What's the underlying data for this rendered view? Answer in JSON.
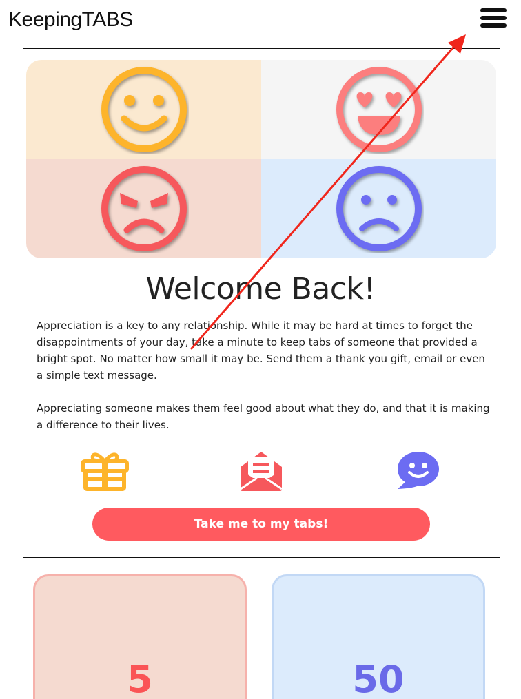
{
  "header": {
    "brand": "KeepingTABS",
    "menu_icon": "hamburger-menu-icon"
  },
  "mood_grid": {
    "cells": [
      {
        "icon": "smile-face-icon",
        "color": "#fdb42b",
        "background": "#fbe9d0"
      },
      {
        "icon": "heart-eyes-face-icon",
        "color": "#fc7e7e",
        "background": "#f5f5f5"
      },
      {
        "icon": "angry-face-icon",
        "color": "#f6585c",
        "background": "#f5dad0"
      },
      {
        "icon": "sad-face-icon",
        "color": "#6c6cf2",
        "background": "#dcebfc"
      }
    ]
  },
  "main": {
    "title": "Welcome Back!",
    "paragraph1": "Appreciation is a key to any relationship. While it may be hard at times to forget the disappointments of your day, take a minute to keep tabs of someone that provided a bright spot. No matter how small it may be. Send them a thank you gift, email or even a simple text message.",
    "paragraph2": "Appreciating someone makes them feel good about what they do, and that it is making a difference to their lives."
  },
  "actions": [
    {
      "icon": "gift-icon",
      "color": "#fdb42b"
    },
    {
      "icon": "open-envelope-icon",
      "color": "#f6585c"
    },
    {
      "icon": "chat-bubble-icon",
      "color": "#6c6cf2"
    }
  ],
  "cta": {
    "label": "Take me to my tabs!",
    "color": "#ff5a5f"
  },
  "stats": [
    {
      "value": "5",
      "color": "#fa5456"
    },
    {
      "value": "50",
      "color": "#6a6ae8"
    }
  ],
  "annotation": {
    "icon": "red-arrow-icon",
    "color": "#f0261c"
  }
}
